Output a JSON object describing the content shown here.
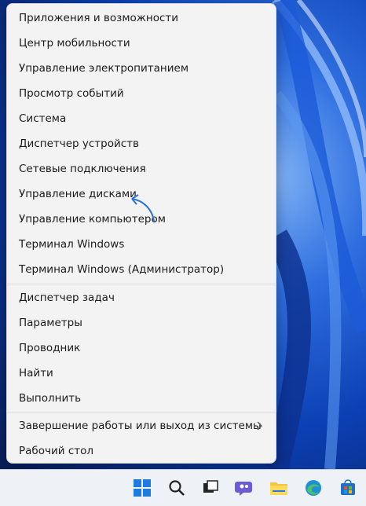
{
  "menu": {
    "items": [
      "Приложения и возможности",
      "Центр мобильности",
      "Управление электропитанием",
      "Просмотр событий",
      "Система",
      "Диспетчер устройств",
      "Сетевые подключения",
      "Управление дисками",
      "Управление компьютером",
      "Терминал Windows",
      "Терминал Windows (Администратор)",
      "Диспетчер задач",
      "Параметры",
      "Проводник",
      "Найти",
      "Выполнить",
      "Завершение работы или выход из системы",
      "Рабочий стол"
    ]
  },
  "taskbar": {
    "icons": [
      "windows-start-icon",
      "search-icon",
      "task-view-icon",
      "chat-icon",
      "file-explorer-icon",
      "edge-icon",
      "store-icon"
    ]
  },
  "colors": {
    "accent": "#0a64d8",
    "menu_bg": "#f3f3f3",
    "taskbar_bg": "#eef1f6"
  }
}
